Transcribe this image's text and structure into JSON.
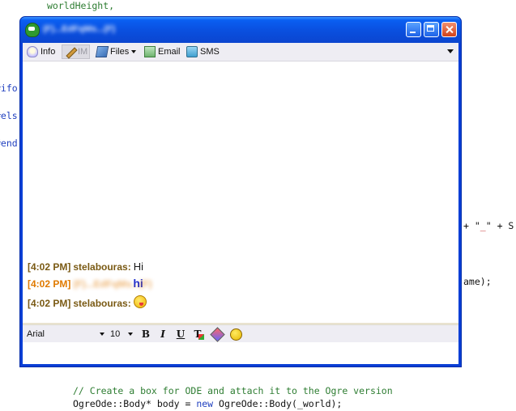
{
  "editor": {
    "line1": "worldHeight,",
    "fragment_ifo": "#ifo",
    "fragment_els": "#els",
    "fragment_end": "#end",
    "fragment_plus_open": "+ \"",
    "fragment_underscore": "_",
    "fragment_plus_close": "\" + S",
    "fragment_name": "ame);",
    "comment_line": "// Create a box for ODE and attach it to the Ogre version",
    "code_line_a": "OgreOde::Body* body = ",
    "code_line_kw": "new",
    "code_line_b": " OgreOde::Body(_world);"
  },
  "window": {
    "title": "(F)...EdFqMs...(F)"
  },
  "toolbar": {
    "info": "Info",
    "im": "IM",
    "files": "Files",
    "email": "Email",
    "sms": "SMS"
  },
  "messages": [
    {
      "time": "[4:02 PM]",
      "sender": "stelabouras:",
      "text": "Hi"
    },
    {
      "time": "[4:02 PM]",
      "sender": "(F)...EdFqMs...(F)",
      "text": "hi"
    },
    {
      "time": "[4:02 PM]",
      "sender": "stelabouras:",
      "emoticon": "tongue-smiley"
    }
  ],
  "format": {
    "font": "Arial",
    "size": "10",
    "bold": "B",
    "italic": "I",
    "underline": "U",
    "color": "T"
  }
}
